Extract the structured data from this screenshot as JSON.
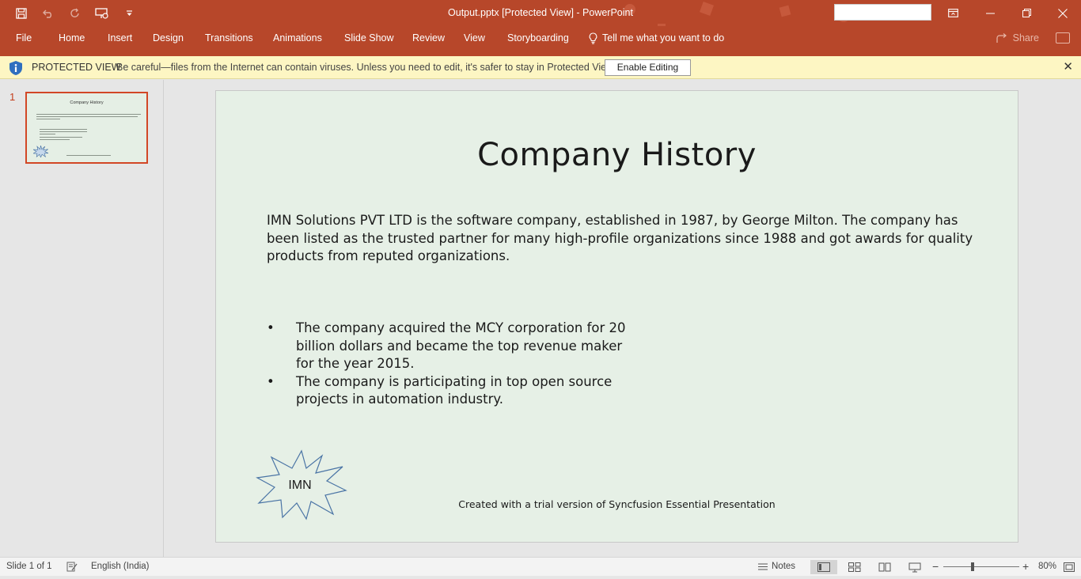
{
  "window": {
    "title": "Output.pptx [Protected View]  -  PowerPoint",
    "controls": [
      "minimize",
      "restore",
      "close"
    ]
  },
  "quick_access": {
    "icons": [
      "save-icon",
      "undo-icon",
      "redo-icon",
      "start-from-beginning-icon",
      "customize-qat-icon"
    ]
  },
  "ribbon": {
    "tabs": [
      "File",
      "Home",
      "Insert",
      "Design",
      "Transitions",
      "Animations",
      "Slide Show",
      "Review",
      "View",
      "Storyboarding"
    ],
    "tell_me": "Tell me what you want to do",
    "share": "Share"
  },
  "protected_view": {
    "title": "PROTECTED VIEW",
    "message": "Be careful—files from the Internet can contain viruses. Unless you need to edit, it's safer to stay in Protected View.",
    "enable_button": "Enable Editing"
  },
  "thumbnails": [
    {
      "number": "1",
      "title": "Company History",
      "selected": true
    }
  ],
  "slide": {
    "title": "Company History",
    "paragraph": "IMN Solutions PVT LTD is the software company, established in 1987, by George Milton. The company has been listed as the trusted partner for many high-profile organizations since 1988 and got awards for quality products from reputed organizations.",
    "bullets": [
      "The company acquired the MCY corporation for 20 billion dollars and became the top revenue maker for the year 2015.",
      "The company is participating in top open source projects in automation industry."
    ],
    "bullet_char": "•",
    "shape_label": "IMN",
    "footer": "Created with a trial version of Syncfusion Essential Presentation"
  },
  "status_bar": {
    "slide_info": "Slide 1 of 1",
    "language": "English (India)",
    "notes": "Notes",
    "zoom": "80%"
  },
  "colors": {
    "accent": "#b7472a",
    "slide_bg": "#e6f0e6",
    "protected_bar": "#fdf6c3",
    "selection": "#d24726"
  }
}
